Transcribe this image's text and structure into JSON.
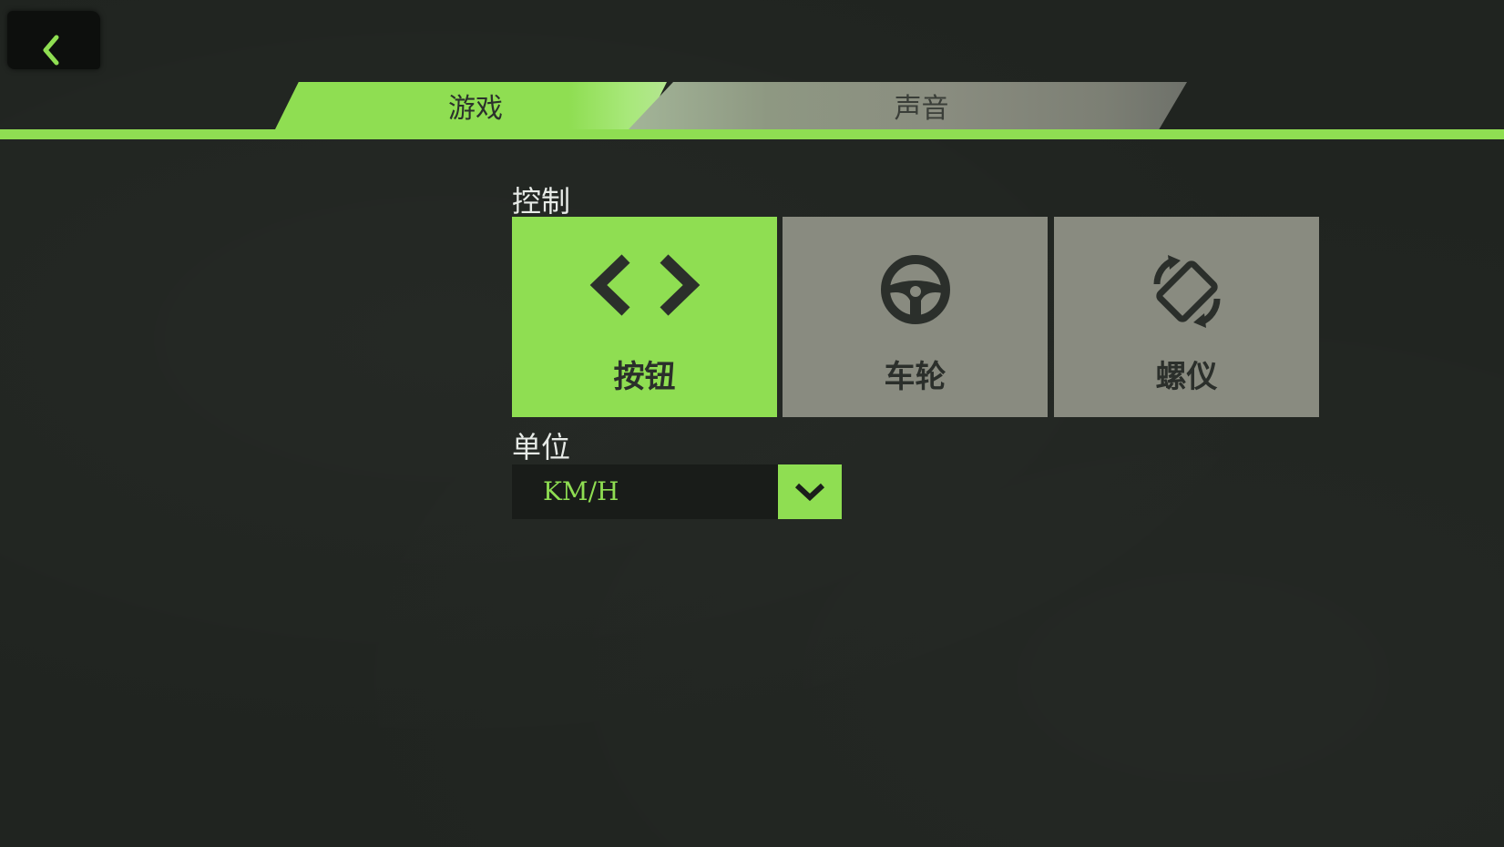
{
  "tabs": {
    "game_label": "游戏",
    "sound_label": "声音"
  },
  "controls": {
    "section_label": "控制",
    "options": [
      {
        "label": "按钮",
        "icon": "arrows-left-right-icon",
        "selected": true
      },
      {
        "label": "车轮",
        "icon": "steering-wheel-icon",
        "selected": false
      },
      {
        "label": "螺仪",
        "icon": "rotate-device-icon",
        "selected": false
      }
    ]
  },
  "units": {
    "section_label": "单位",
    "selected_value": "KM/H"
  },
  "colors": {
    "accent": "#8fde52",
    "background": "#202420",
    "card_inactive": "#898b80",
    "icon_dark": "#2b2f2b"
  }
}
